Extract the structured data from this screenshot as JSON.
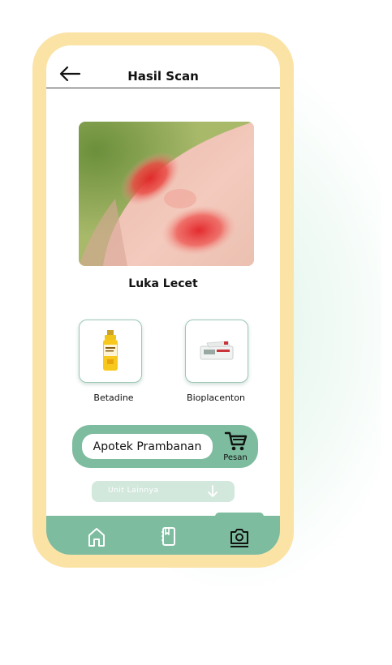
{
  "header": {
    "title": "Hasil Scan",
    "back_icon": "arrow-left-icon"
  },
  "result": {
    "diagnosis": "Luka Lecet"
  },
  "medicines": [
    {
      "name": "Betadine",
      "icon": "antiseptic-bottle-icon"
    },
    {
      "name": "Bioplacenton",
      "icon": "ointment-tube-icon"
    }
  ],
  "pharmacy": {
    "name": "Apotek Prambanan",
    "order_label": "Pesan",
    "order_icon": "cart-icon"
  },
  "other_units": {
    "label": "Unit Lainnya",
    "icon": "arrow-down-icon"
  },
  "nav": {
    "items": [
      "home-icon",
      "book-icon",
      "camera-icon"
    ],
    "active": "camera-icon"
  },
  "colors": {
    "accent": "#7dbc9e",
    "frame": "#fbe3a6",
    "muted_button": "#d3e8dd"
  }
}
